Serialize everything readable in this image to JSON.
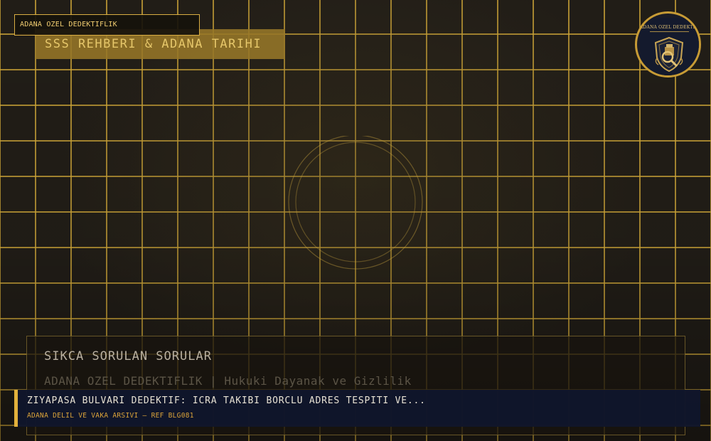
{
  "brand": {
    "tag": "ADANA OZEL DEDEKTIFLIK",
    "logo_text": "ADANA OZEL DEDEKTIFLIK"
  },
  "banner": {
    "title": "SSS REHBERI & ADANA TARIHI"
  },
  "faq": {
    "title": "SIKCA SORULAN SORULAR",
    "subtitle": "ADANA OZEL DEDEKTIFLIK | Hukuki Dayanak ve Gizlilik"
  },
  "ticker": {
    "headline": "ZIYAPASA BULVARI DEDEKTIF: ICRA TAKIBI BORCLU ADRES TESPITI VE...",
    "reference": "ADANA DELIL VE VAKA ARSIVI — REF BLG081"
  },
  "colors": {
    "grid": "#cda537",
    "accent": "#e2b13c",
    "ticker_bg": "#10162c"
  },
  "icons": {
    "logo": "shield-magnifier-emblem",
    "decor": "concentric-rings"
  }
}
